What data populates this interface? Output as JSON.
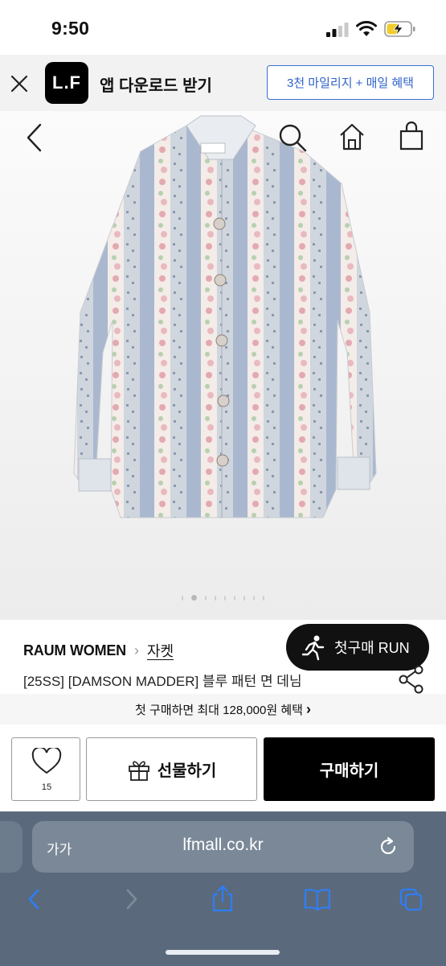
{
  "status_bar": {
    "time": "9:50"
  },
  "app_banner": {
    "logo_text": "L.F",
    "title": "앱 다운로드 받기",
    "button_label": "3천 마일리지 + 매일 혜택"
  },
  "product": {
    "brand": "RAUM WOMEN",
    "category": "자켓",
    "title": "[25SS] [DAMSON MADDER] 블루 패턴 면 데님",
    "carousel": {
      "total": 9,
      "active_index": 1
    }
  },
  "run_button": {
    "label": "첫구매 RUN"
  },
  "promo": {
    "text": "첫 구매하면 최대 128,000원 혜택",
    "arrow": "›"
  },
  "actions": {
    "like_count": "15",
    "gift_label": "선물하기",
    "buy_label": "구매하기"
  },
  "browser": {
    "aa_label": "가가",
    "url": "lfmall.co.kr"
  },
  "icons": {
    "close": "close-icon",
    "back": "back-icon",
    "search": "search-icon",
    "home": "home-icon",
    "bag": "shopping-bag-icon",
    "share": "share-icon",
    "heart": "heart-icon",
    "gift": "gift-icon",
    "runner": "runner-icon"
  },
  "colors": {
    "banner_accent": "#2f63c9",
    "buy_button": "#000000",
    "browser_chrome": "#5a6a7c",
    "safari_blue": "#2f7df6"
  }
}
